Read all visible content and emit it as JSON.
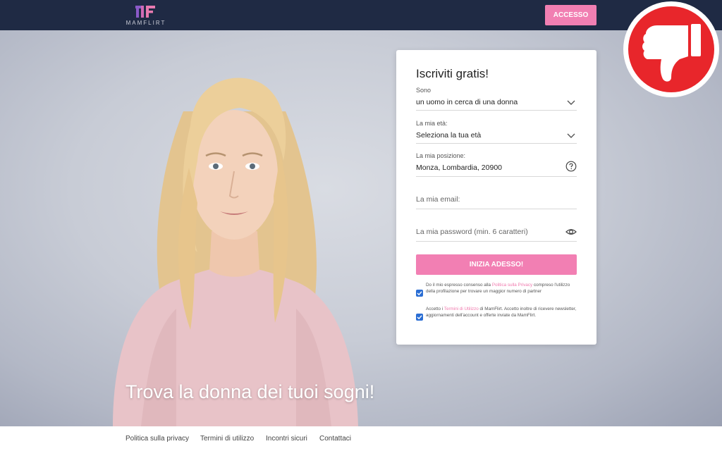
{
  "header": {
    "logo_text": "MAMFLIRT",
    "login_label": "ACCESSO"
  },
  "hero": {
    "title": "Trova la donna dei tuoi sogni!"
  },
  "signup": {
    "title": "Iscriviti gratis!",
    "sono_label": "Sono",
    "sono_value": "un uomo in cerca di una donna",
    "age_label": "La mia età:",
    "age_value": "Seleziona la tua età",
    "position_label": "La mia posizione:",
    "position_value": "Monza, Lombardia, 20900",
    "email_placeholder": "La mia email:",
    "password_placeholder": "La mia password (min. 6 caratteri)",
    "start_label": "INIZIA ADESSO!",
    "consent1_pre": "Do il mio espresso consenso alla ",
    "consent1_link": "Politica sulla Privacy",
    "consent1_post": " compreso l'utilizzo della profilazione per trovare un maggior numero di partner",
    "consent2_pre": "Accetto i ",
    "consent2_link": "Termini di Utilizzo",
    "consent2_post": " di MamFlirt. Accetto inoltre di ricevere newsletter, aggiornamenti dell'account e offerte inviate da MamFlirt."
  },
  "footer": {
    "links": [
      "Politica sulla privacy",
      "Termini di utilizzo",
      "Incontri sicuri",
      "Contattaci"
    ]
  },
  "colors": {
    "header_bg": "#1f2a44",
    "accent_pink": "#f17fb2",
    "checkbox_blue": "#2b6ed4",
    "badge_red": "#e8262b"
  },
  "icons": {
    "badge": "thumbs-down-icon",
    "help": "question-circle-icon",
    "password_toggle": "eye-icon",
    "select": "chevron-down-icon"
  }
}
